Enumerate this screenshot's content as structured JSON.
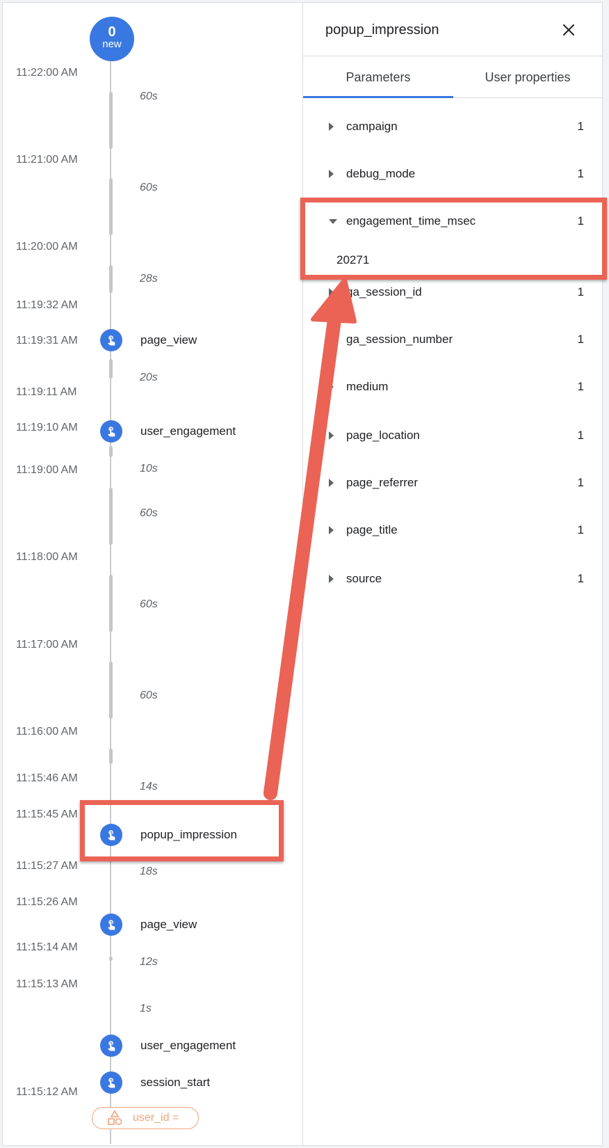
{
  "timeline": {
    "new_badge": {
      "count": "0",
      "label": "new"
    },
    "times": [
      "11:22:00 AM",
      "11:21:00 AM",
      "11:20:00 AM",
      "11:19:32 AM",
      "11:19:31 AM",
      "11:19:11 AM",
      "11:19:10 AM",
      "11:19:00 AM",
      "11:18:00 AM",
      "11:17:00 AM",
      "11:16:00 AM",
      "11:15:46 AM",
      "11:15:45 AM",
      "11:15:27 AM",
      "11:15:26 AM",
      "11:15:14 AM",
      "11:15:13 AM",
      "11:15:12 AM"
    ],
    "durations": [
      "60s",
      "60s",
      "28s",
      "20s",
      "10s",
      "60s",
      "60s",
      "60s",
      "14s",
      "18s",
      "12s",
      "1s"
    ],
    "events": [
      "page_view",
      "user_engagement",
      "popup_impression",
      "page_view",
      "user_engagement",
      "session_start"
    ],
    "user_pill": "user_id ="
  },
  "panel": {
    "title": "popup_impression",
    "tabs": [
      "Parameters",
      "User properties"
    ],
    "params": [
      {
        "name": "campaign",
        "count": "1"
      },
      {
        "name": "debug_mode",
        "count": "1"
      },
      {
        "name": "engagement_time_msec",
        "count": "1",
        "value": "20271"
      },
      {
        "name": "ga_session_id",
        "count": "1"
      },
      {
        "name": "ga_session_number",
        "count": "1"
      },
      {
        "name": "medium",
        "count": "1"
      },
      {
        "name": "page_location",
        "count": "1"
      },
      {
        "name": "page_referrer",
        "count": "1"
      },
      {
        "name": "page_title",
        "count": "1"
      },
      {
        "name": "source",
        "count": "1"
      }
    ]
  },
  "colors": {
    "accent": "#3a78e1",
    "annotation": "#ea6355",
    "user_pill": "#f0a27a"
  },
  "icons": {
    "event": "touch-hand-icon",
    "close": "close-icon",
    "user": "shapes-icon",
    "expand": "triangle-right-icon",
    "collapse": "triangle-down-icon"
  }
}
